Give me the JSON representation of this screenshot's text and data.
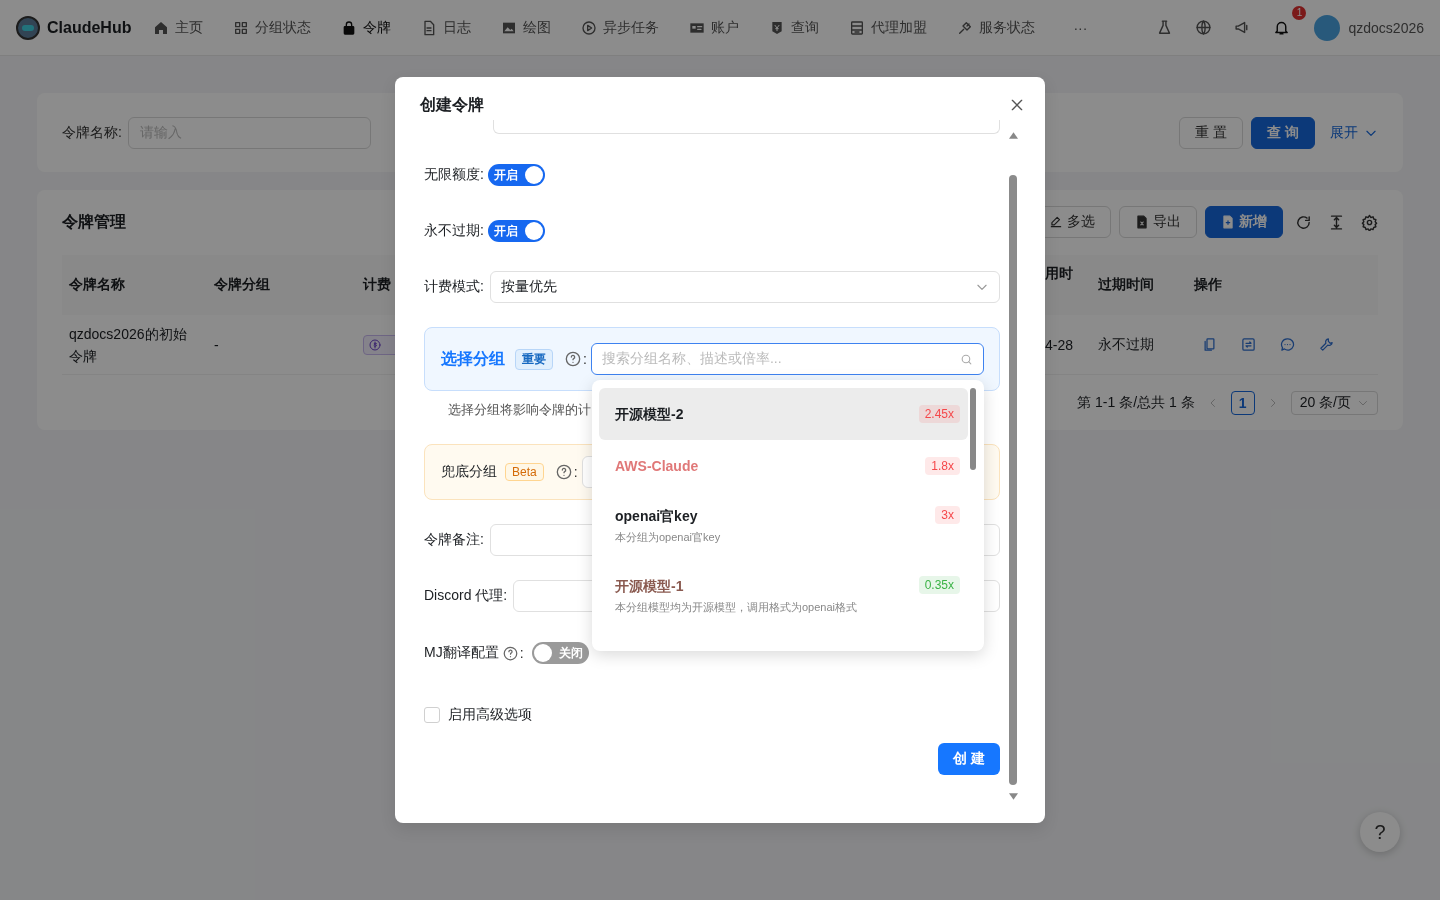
{
  "nav": {
    "brand": "ClaudeHub",
    "items": [
      {
        "label": "主页",
        "selected": false
      },
      {
        "label": "分组状态",
        "selected": false
      },
      {
        "label": "令牌",
        "selected": true
      },
      {
        "label": "日志",
        "selected": false
      },
      {
        "label": "绘图",
        "selected": false
      },
      {
        "label": "异步任务",
        "selected": false
      },
      {
        "label": "账户",
        "selected": false
      },
      {
        "label": "查询",
        "selected": false
      },
      {
        "label": "代理加盟",
        "selected": false
      },
      {
        "label": "服务状态",
        "selected": false
      }
    ],
    "more": "···",
    "notification_count": "1",
    "username": "qzdocs2026"
  },
  "search_panel": {
    "label": "令牌名称:",
    "placeholder": "请输入",
    "buttons": [
      {
        "label": "重 置",
        "kind": "default"
      },
      {
        "label": "查 询",
        "kind": "primary"
      }
    ],
    "expand": "展开"
  },
  "table_panel": {
    "title": "令牌管理",
    "toolbar": [
      {
        "label": "多选",
        "kind": "default"
      },
      {
        "label": "导出",
        "kind": "default"
      },
      {
        "label": "新增",
        "kind": "primary"
      }
    ],
    "columns": [
      "令牌名称",
      "令牌分组",
      "计费",
      "用时",
      "过期时间",
      "操作"
    ],
    "rows": [
      {
        "name": "qzdocs2026的初始令牌",
        "group": "-",
        "last_used": "4-28",
        "expires": "永不过期"
      }
    ],
    "pagination": {
      "summary": "第 1-1 条/总共 1 条",
      "pages": [
        {
          "label": "1",
          "selected": true
        }
      ],
      "page_size": "20 条/页"
    }
  },
  "help_button": "?",
  "modal": {
    "title": "创建令牌",
    "fields": [
      {
        "kind": "stub"
      },
      {
        "kind": "switch",
        "label": "无限额度:",
        "on": true,
        "text": "开启"
      },
      {
        "kind": "switch",
        "label": "永不过期:",
        "on": true,
        "text": "开启"
      },
      {
        "kind": "select",
        "label": "计费模式:",
        "value": "按量优先"
      },
      {
        "kind": "group_select",
        "title": "选择分组",
        "tag": "重要",
        "suffix": ":",
        "placeholder": "搜索分组名称、描述或倍率...",
        "hint": "选择分组将影响令牌的计"
      },
      {
        "kind": "fallback",
        "label": "兜底分组",
        "tag": "Beta",
        "suffix": ":"
      },
      {
        "kind": "input",
        "label": "令牌备注:"
      },
      {
        "kind": "input",
        "label": "Discord 代理:"
      },
      {
        "kind": "switch",
        "label": "MJ翻译配置",
        "suffix": ":",
        "on": false,
        "text": "关闭"
      },
      {
        "kind": "checkbox",
        "label": "启用高级选项",
        "checked": false
      }
    ],
    "submit": "创 建",
    "dropdown": [
      {
        "name": "开源模型-2",
        "color": "#1c1f23",
        "selected": true,
        "ratio": {
          "text": "2.45x",
          "color": "#f5474a"
        }
      },
      {
        "name": "AWS-Claude",
        "color": "#e07878",
        "selected": false,
        "ratio": {
          "text": "1.8x",
          "color": "#f5474a"
        }
      },
      {
        "name": "openai官key",
        "color": "#1c1f23",
        "selected": false,
        "description": "本分组为openai官key",
        "ratio": {
          "text": "3x",
          "color": "#f5474a"
        }
      },
      {
        "name": "开源模型-1",
        "color": "#8a5a50",
        "selected": false,
        "description": "本分组模型均为开源模型，调用格式为openai格式",
        "ratio": {
          "text": "0.35x",
          "color": "#3bb346"
        }
      }
    ]
  }
}
